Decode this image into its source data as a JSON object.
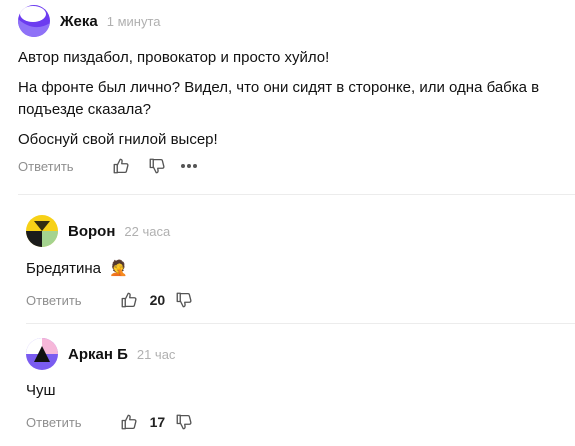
{
  "comments": [
    {
      "author": "Жека",
      "time": "1 минута",
      "paragraphs": [
        "Автор пиздабол, провокатор и просто хуйло!",
        "На фронте был лично? Видел, что они сидят в сторонке, или одна бабка в подъезде сказала?",
        "Обоснуй свой гнилой высер!"
      ],
      "reply_label": "Ответить",
      "like_icon": "thumb-up-icon",
      "dislike_icon": "thumb-down-icon",
      "more_icon": "more-horizontal-icon",
      "avatar_colors": [
        "#6c3cf0",
        "#ffffff"
      ]
    },
    {
      "author": "Ворон",
      "time": "22 часа",
      "text": "Бредятина",
      "emoji": "🤦",
      "reply_label": "Ответить",
      "likes": "20",
      "avatar_colors": [
        "#f7d117",
        "#1b1b1b",
        "#a4d38f"
      ]
    },
    {
      "author": "Аркан Б",
      "time": "21 час",
      "text": "Чуш",
      "reply_label": "Ответить",
      "likes": "17",
      "avatar_colors": [
        "#7a5cf0",
        "#f6b7d9",
        "#111111"
      ]
    }
  ]
}
